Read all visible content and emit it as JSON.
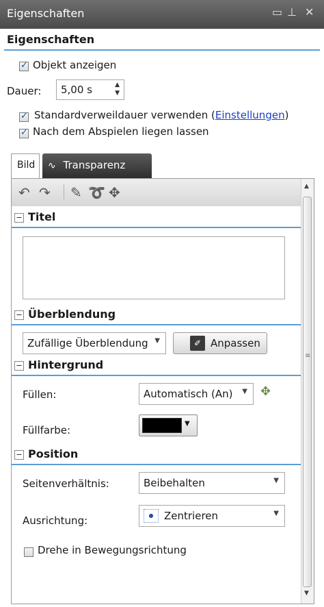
{
  "window": {
    "title": "Eigenschaften"
  },
  "panel": {
    "heading": "Eigenschaften"
  },
  "general": {
    "show_object_label": "Objekt anzeigen",
    "show_object_checked": true,
    "duration_label": "Dauer:",
    "duration_value": "5,00 s",
    "default_duration_label": "Standardverweildauer verwenden (",
    "default_duration_link": "Einstellungen",
    "default_duration_close": ")",
    "default_duration_checked": true,
    "keep_after_play_label": "Nach dem Abspielen liegen lassen",
    "keep_after_play_checked": true
  },
  "tabs": [
    {
      "label": "Bild",
      "active": true
    },
    {
      "label": "Transparenz",
      "active": false
    }
  ],
  "toolbar": {
    "icons": [
      "undo-icon",
      "redo-icon",
      "brush-icon",
      "lasso-icon",
      "move-icon"
    ]
  },
  "sections": {
    "titel": {
      "label": "Titel",
      "text": ""
    },
    "ueberblendung": {
      "label": "Überblendung",
      "select_value": "Zufällige Überblendung",
      "customize_label": "Anpassen"
    },
    "hintergrund": {
      "label": "Hintergrund",
      "fill_label": "Füllen:",
      "fill_value": "Automatisch (An)",
      "fill_color_label": "Füllfarbe:",
      "fill_color": "#000000"
    },
    "position": {
      "label": "Position",
      "aspect_label": "Seitenverhältnis:",
      "aspect_value": "Beibehalten",
      "align_label": "Ausrichtung:",
      "align_value": "Zentrieren",
      "rotate_label": "Drehe in Bewegungsrichtung",
      "rotate_checked": false
    }
  },
  "colors": {
    "accent": "#5b9bd5",
    "titlebar": "#555555",
    "link": "#1a3fc4"
  }
}
